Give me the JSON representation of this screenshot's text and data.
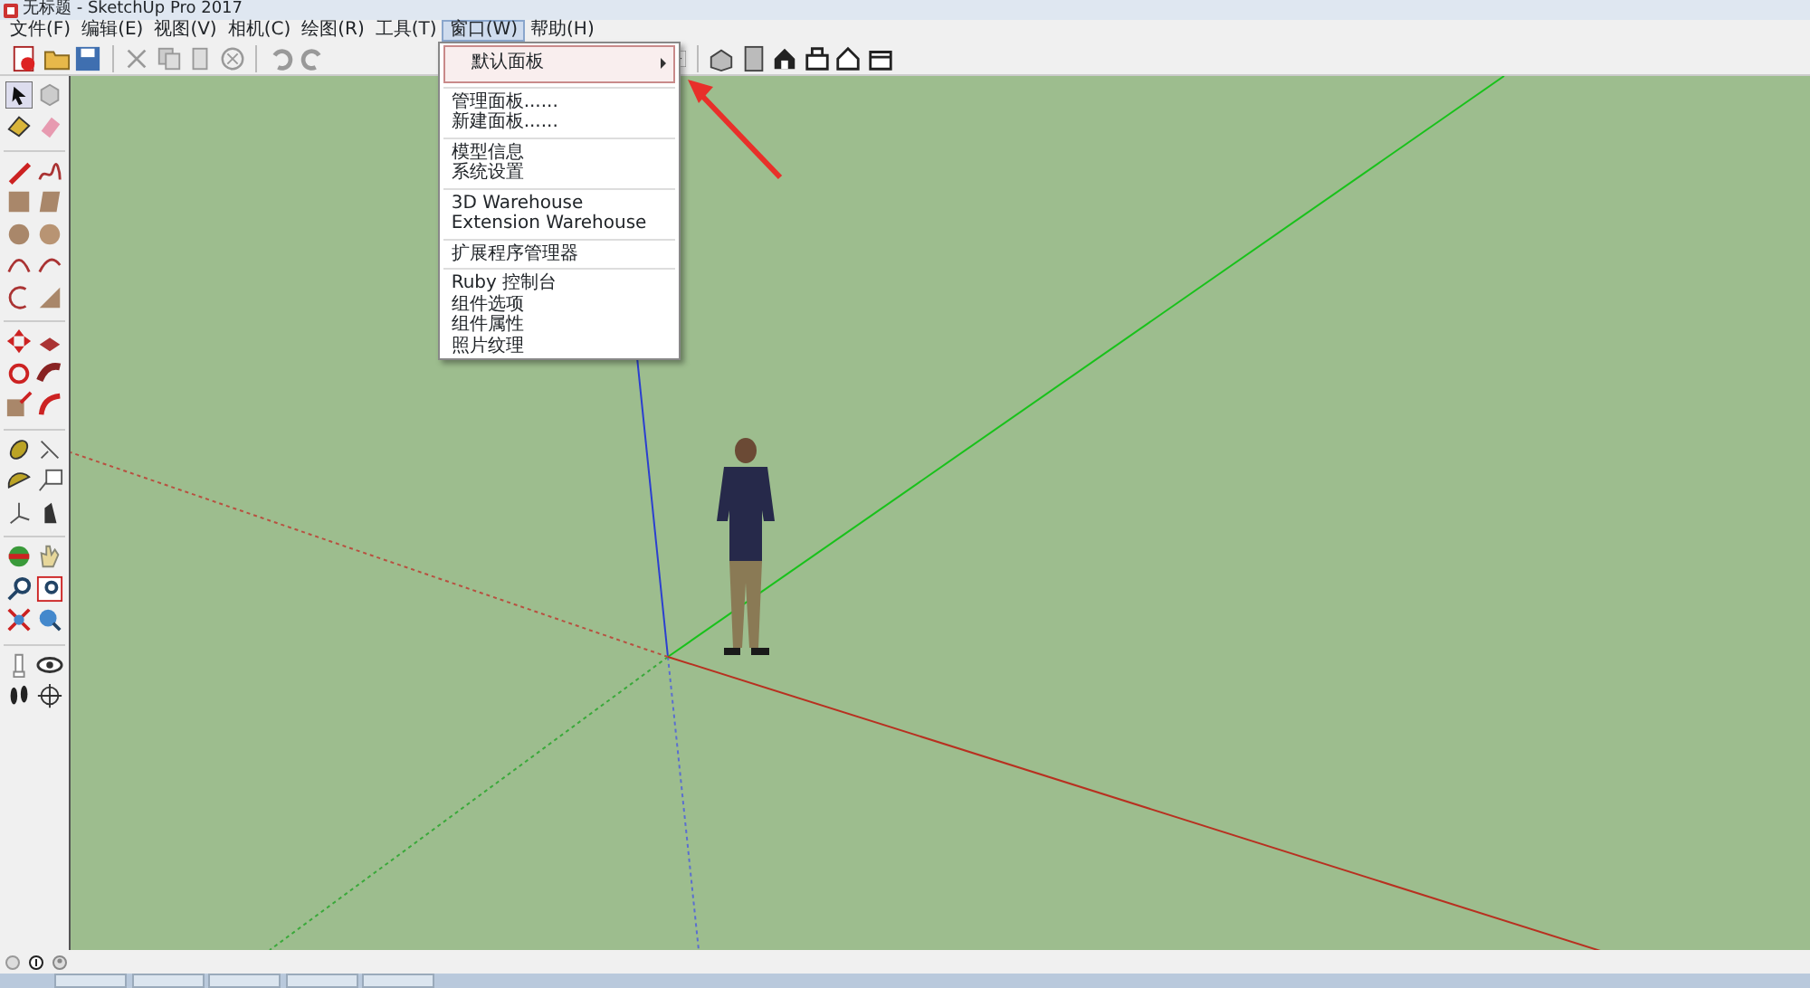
{
  "window": {
    "title": "无标题 - SketchUp Pro 2017"
  },
  "menu_bar": [
    {
      "label": "文件(F)",
      "selected": false
    },
    {
      "label": "编辑(E)",
      "selected": false
    },
    {
      "label": "视图(V)",
      "selected": false
    },
    {
      "label": "相机(C)",
      "selected": false
    },
    {
      "label": "绘图(R)",
      "selected": false
    },
    {
      "label": "工具(T)",
      "selected": false
    },
    {
      "label": "窗口(W)",
      "selected": true
    },
    {
      "label": "帮助(H)",
      "selected": false
    }
  ],
  "open_menu": {
    "groups": [
      [
        {
          "label": "默认面板",
          "has_submenu": true,
          "selected": true
        }
      ],
      [
        {
          "label": "管理面板......",
          "has_submenu": false,
          "selected": false
        },
        {
          "label": "新建面板......",
          "has_submenu": false,
          "selected": false
        }
      ],
      [
        {
          "label": "模型信息",
          "has_submenu": false,
          "selected": false
        },
        {
          "label": "系统设置",
          "has_submenu": false,
          "selected": false
        }
      ],
      [
        {
          "label": "3D Warehouse",
          "has_submenu": false,
          "selected": false
        },
        {
          "label": "Extension Warehouse",
          "has_submenu": false,
          "selected": false
        }
      ],
      [
        {
          "label": "扩展程序管理器",
          "has_submenu": false,
          "selected": false
        }
      ],
      [
        {
          "label": "Ruby 控制台",
          "has_submenu": false,
          "selected": false
        },
        {
          "label": "组件选项",
          "has_submenu": false,
          "selected": false
        },
        {
          "label": "组件属性",
          "has_submenu": false,
          "selected": false
        },
        {
          "label": "照片纹理",
          "has_submenu": false,
          "selected": false
        }
      ]
    ]
  }
}
